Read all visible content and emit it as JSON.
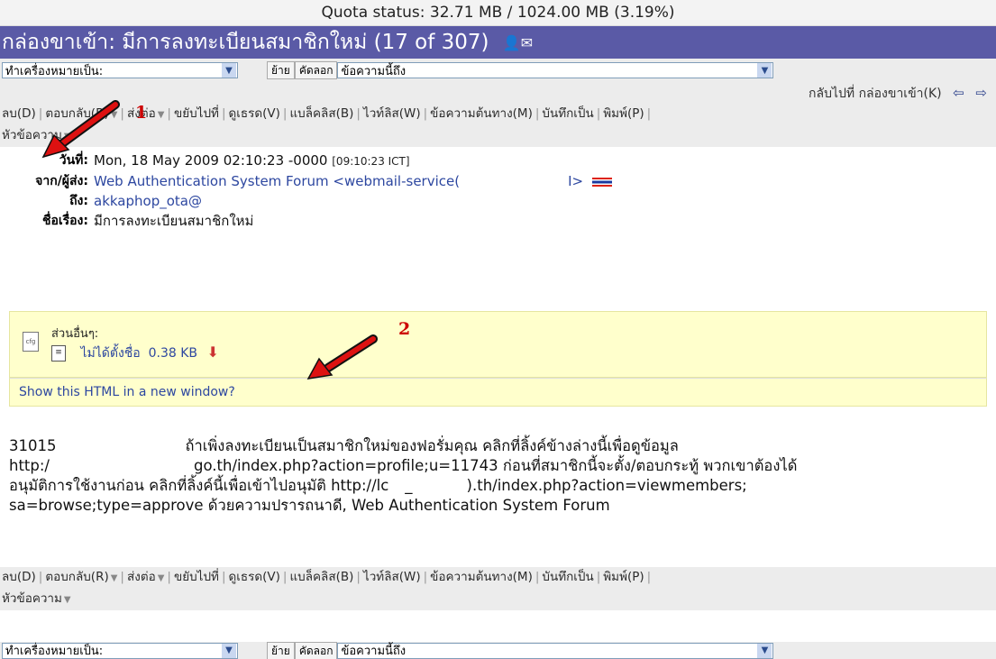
{
  "quota": "Quota status: 32.71 MB / 1024.00 MB (3.19%)",
  "title": "กล่องขาเข้า: มีการลงทะเบียนสมาชิกใหม่ (17 of 307)",
  "title_icons": "👤✉",
  "mark_as": {
    "value": "ทำเครื่องหมายเป็น:",
    "icon": "chevron-down-icon"
  },
  "move_label": "ย้าย",
  "copy_label": "คัดลอก",
  "move_target": {
    "value": "ข้อความนี้ถึง",
    "icon": "chevron-down-icon"
  },
  "back_to": {
    "prefix": "กลับไปที่ ",
    "link": "กล่องขาเข้า(K)",
    "prev_icon": "arrow-left-icon",
    "next_icon": "arrow-right-icon",
    "arrows": "⇦ ⇨"
  },
  "toolbar": {
    "delete": "ลบ(D)",
    "reply": "ตอบกลับ(R)",
    "forward": "ส่งต่อ",
    "move_to": "ขยับไปที่",
    "thread": "ดูเธรด(V)",
    "blacklist": "แบล็คลิส(B)",
    "whitelist": "ไวท์ลิส(W)",
    "source": "ข้อความต้นทาง(M)",
    "save_as": "บันทึกเป็น",
    "print": "พิมพ์(P)",
    "headers": "หัวข้อความ"
  },
  "headers": {
    "date_label": "วันที่:",
    "date_value": "Mon, 18 May 2009 02:10:23 -0000",
    "date_local": "[09:10:23 ICT]",
    "from_label": "จาก/ผู้ส่ง:",
    "from_value": "Web Authentication System Forum <webmail-service(",
    "from_tail": "I>",
    "to_label": "ถึง:",
    "to_value": "akkaphop_ota@",
    "subject_label": "ชื่อเรื่อง:",
    "subject_value": "มีการลงทะเบียนสมาชิกใหม่"
  },
  "attachments": {
    "label": "ส่วนอื่นๆ:",
    "file_name": "ไม่ได้ตั้งชื่อ",
    "file_size": "0.38 KB",
    "download_icon": "download-icon",
    "show_html": "Show this HTML in a new window?"
  },
  "body": {
    "line1_num": "31015",
    "line1": "ถ้าเพิ่งลงทะเบียนเป็นสมาชิกใหม่ของฟอรั่มคุณ คลิกที่ลิ้งค์ข้างล่างนี้เพื่อดูข้อมูล",
    "line2a": "http:/",
    "line2b": "go.th/index.php?action=profile;u=11743 ก่อนที่สมาชิกนี้จะตั้ง/ตอบกระทู้ พวกเขาต้องได้",
    "line3a": "อนุมัติการใช้งานก่อน คลิกที่ลิ้งค์นี้เพื่อเข้าไปอนุมัติ http://lc",
    "line3b": "_",
    "line3c": ").th/index.php?action=viewmembers;",
    "line4": "sa=browse;type=approve ด้วยความปรารถนาดี, Web Authentication System Forum"
  },
  "annotations": {
    "one": "1",
    "two": "2"
  },
  "colors": {
    "title_bar": "#5a5aa6",
    "link": "#2d47a0",
    "attachment_bg": "#ffffcc",
    "annotation_red": "#dd1111"
  }
}
